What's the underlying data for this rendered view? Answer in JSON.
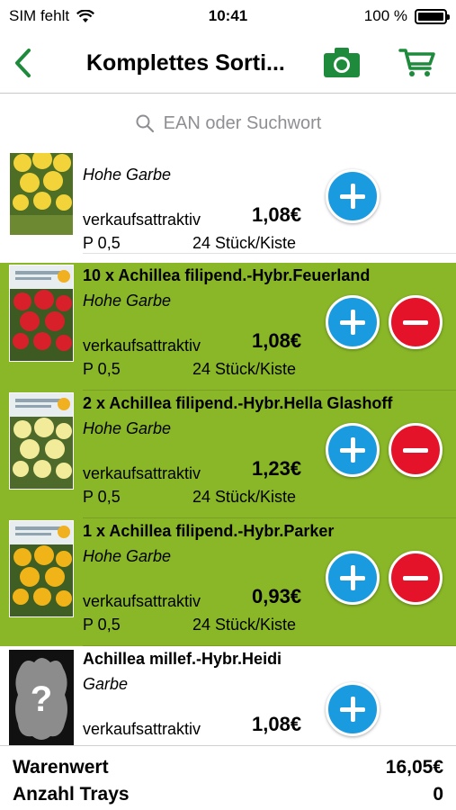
{
  "status_bar": {
    "carrier": "SIM fehlt",
    "time": "10:41",
    "battery": "100 %"
  },
  "nav": {
    "title": "Komplettes Sorti...",
    "back_icon": "chevron-left-icon",
    "camera_icon": "camera-icon",
    "cart_icon": "cart-icon",
    "accent": "#1e8a3b"
  },
  "search": {
    "placeholder": "EAN oder Suchwort"
  },
  "colors": {
    "selected_row": "#8ab728",
    "plus": "#1a9be0",
    "minus": "#e4132a"
  },
  "items": [
    {
      "name": "",
      "subtitle": "Hohe Garbe",
      "attr": "verkaufsattraktiv",
      "price": "1,08€",
      "p": "P 0,5",
      "pack": "24 Stück/Kiste",
      "selected": false
    },
    {
      "name": "10 x Achillea filipend.-Hybr.Feuerland",
      "subtitle": "Hohe Garbe",
      "attr": "verkaufsattraktiv",
      "price": "1,08€",
      "p": "P 0,5",
      "pack": "24 Stück/Kiste",
      "selected": true
    },
    {
      "name": "2 x Achillea filipend.-Hybr.Hella Glashoff",
      "subtitle": "Hohe Garbe",
      "attr": "verkaufsattraktiv",
      "price": "1,23€",
      "p": "P 0,5",
      "pack": "24 Stück/Kiste",
      "selected": true
    },
    {
      "name": "1 x Achillea filipend.-Hybr.Parker",
      "subtitle": "Hohe Garbe",
      "attr": "verkaufsattraktiv",
      "price": "0,93€",
      "p": "P 0,5",
      "pack": "24 Stück/Kiste",
      "selected": true
    },
    {
      "name": "Achillea millef.-Hybr.Heidi",
      "subtitle": "Garbe",
      "attr": "verkaufsattraktiv",
      "price": "1,08€",
      "p": "",
      "pack": "",
      "selected": false
    }
  ],
  "footer": {
    "warenwert_label": "Warenwert",
    "warenwert_value": "16,05€",
    "trays_label": "Anzahl Trays",
    "trays_value": "0"
  }
}
